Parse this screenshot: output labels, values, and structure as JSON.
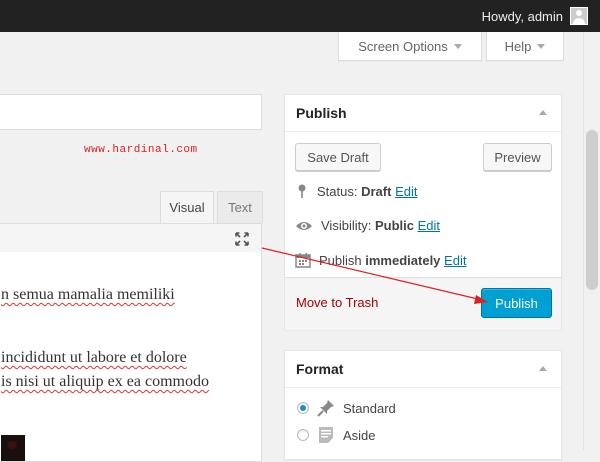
{
  "adminbar": {
    "greeting": "Howdy, admin"
  },
  "screen_meta": {
    "screen_options": "Screen Options",
    "help": "Help"
  },
  "watermark": "www.hardinal.com",
  "editor": {
    "tabs": [
      "Visual",
      "Text"
    ],
    "lines": [
      "n semua mamalia memiliki",
      "incididunt ut labore et dolore",
      "is nisi ut aliquip ex ea commodo"
    ]
  },
  "publish_box": {
    "title": "Publish",
    "save_draft": "Save Draft",
    "preview": "Preview",
    "status_label": "Status:",
    "status_value": "Draft",
    "visibility_label": "Visibility:",
    "visibility_value": "Public",
    "publish_label": "Publish",
    "publish_value": "immediately",
    "edit": "Edit",
    "move_to_trash": "Move to Trash",
    "publish_button": "Publish"
  },
  "format_box": {
    "title": "Format",
    "options": [
      {
        "label": "Standard",
        "checked": true
      },
      {
        "label": "Aside",
        "checked": false
      }
    ]
  },
  "colors": {
    "accent": "#00a0d2",
    "link": "#0073aa",
    "trash": "#aa0000",
    "annotation": "#e02020"
  }
}
